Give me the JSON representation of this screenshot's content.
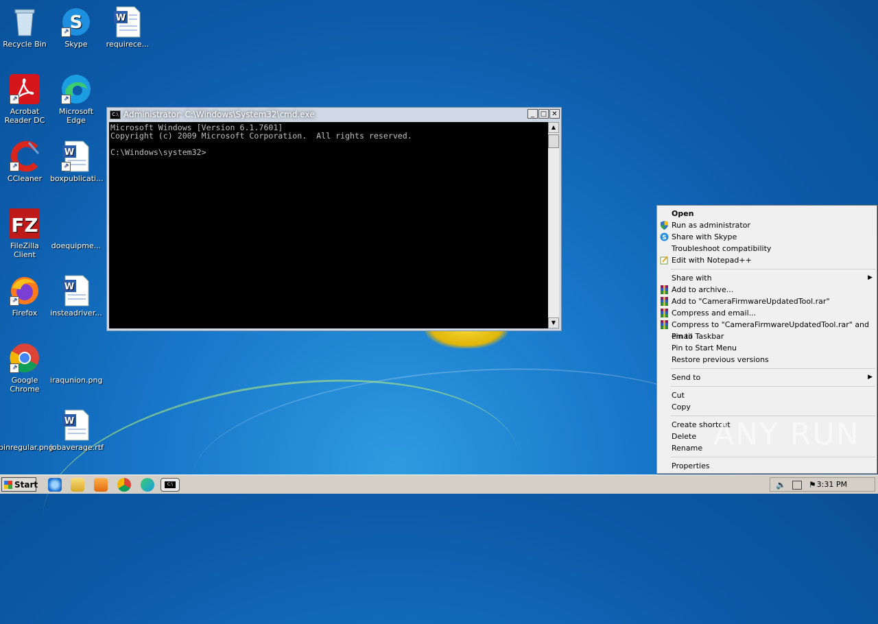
{
  "desktop": {
    "icons": [
      {
        "label": "Recycle Bin",
        "icon": "recycle-bin-icon"
      },
      {
        "label": "Skype",
        "icon": "skype-icon"
      },
      {
        "label": "requirece...",
        "icon": "word-document-icon"
      },
      {
        "label": "Acrobat Reader DC",
        "icon": "acrobat-icon"
      },
      {
        "label": "Microsoft Edge",
        "icon": "edge-icon"
      },
      {
        "label": "CCleaner",
        "icon": "ccleaner-icon"
      },
      {
        "label": "boxpublicati...",
        "icon": "word-document-icon"
      },
      {
        "label": "FileZilla Client",
        "icon": "filezilla-icon"
      },
      {
        "label": "doequipme...",
        "icon": "blank-file-icon"
      },
      {
        "label": "Firefox",
        "icon": "firefox-icon"
      },
      {
        "label": "insteadriver...",
        "icon": "word-document-icon"
      },
      {
        "label": "Google Chrome",
        "icon": "chrome-icon"
      },
      {
        "label": "iraqunion.png",
        "icon": "blank-file-icon"
      },
      {
        "label": "binregular.png",
        "icon": "blank-file-icon"
      },
      {
        "label": "jobaverage.rtf",
        "icon": "word-document-icon"
      }
    ]
  },
  "cmd": {
    "title": "Administrator: C:\\Windows\\System32\\cmd.exe",
    "icon_text": "C:\\",
    "output": "Microsoft Windows [Version 6.1.7601]\nCopyright (c) 2009 Microsoft Corporation.  All rights reserved.\n\nC:\\Windows\\system32>"
  },
  "context_menu": {
    "items": [
      {
        "label": "Open",
        "bold": true
      },
      {
        "label": "Run as administrator",
        "icon": "shield-icon"
      },
      {
        "label": "Share with Skype",
        "icon": "skype-icon"
      },
      {
        "label": "Troubleshoot compatibility"
      },
      {
        "label": "Edit with Notepad++",
        "icon": "notepadpp-icon"
      },
      {
        "label": "Share with",
        "submenu": true
      },
      {
        "label": "Add to archive...",
        "icon": "winrar-icon"
      },
      {
        "label": "Add to \"CameraFirmwareUpdatedTool.rar\"",
        "icon": "winrar-icon"
      },
      {
        "label": "Compress and email...",
        "icon": "winrar-icon"
      },
      {
        "label": "Compress to \"CameraFirmwareUpdatedTool.rar\" and email",
        "icon": "winrar-icon"
      },
      {
        "label": "Pin to Taskbar"
      },
      {
        "label": "Pin to Start Menu"
      },
      {
        "label": "Restore previous versions"
      },
      {
        "label": "Send to",
        "submenu": true
      },
      {
        "label": "Cut"
      },
      {
        "label": "Copy"
      },
      {
        "label": "Create shortcut"
      },
      {
        "label": "Delete"
      },
      {
        "label": "Rename"
      },
      {
        "label": "Properties"
      }
    ]
  },
  "watermark": "ANY RUN",
  "taskbar": {
    "start_label": "Start",
    "clock": "3:31 PM"
  },
  "colors": {
    "desktop_blue": "#0c5aa8",
    "menu_bg": "#f0f0f0",
    "taskbar_bg": "#d4d0c8"
  }
}
